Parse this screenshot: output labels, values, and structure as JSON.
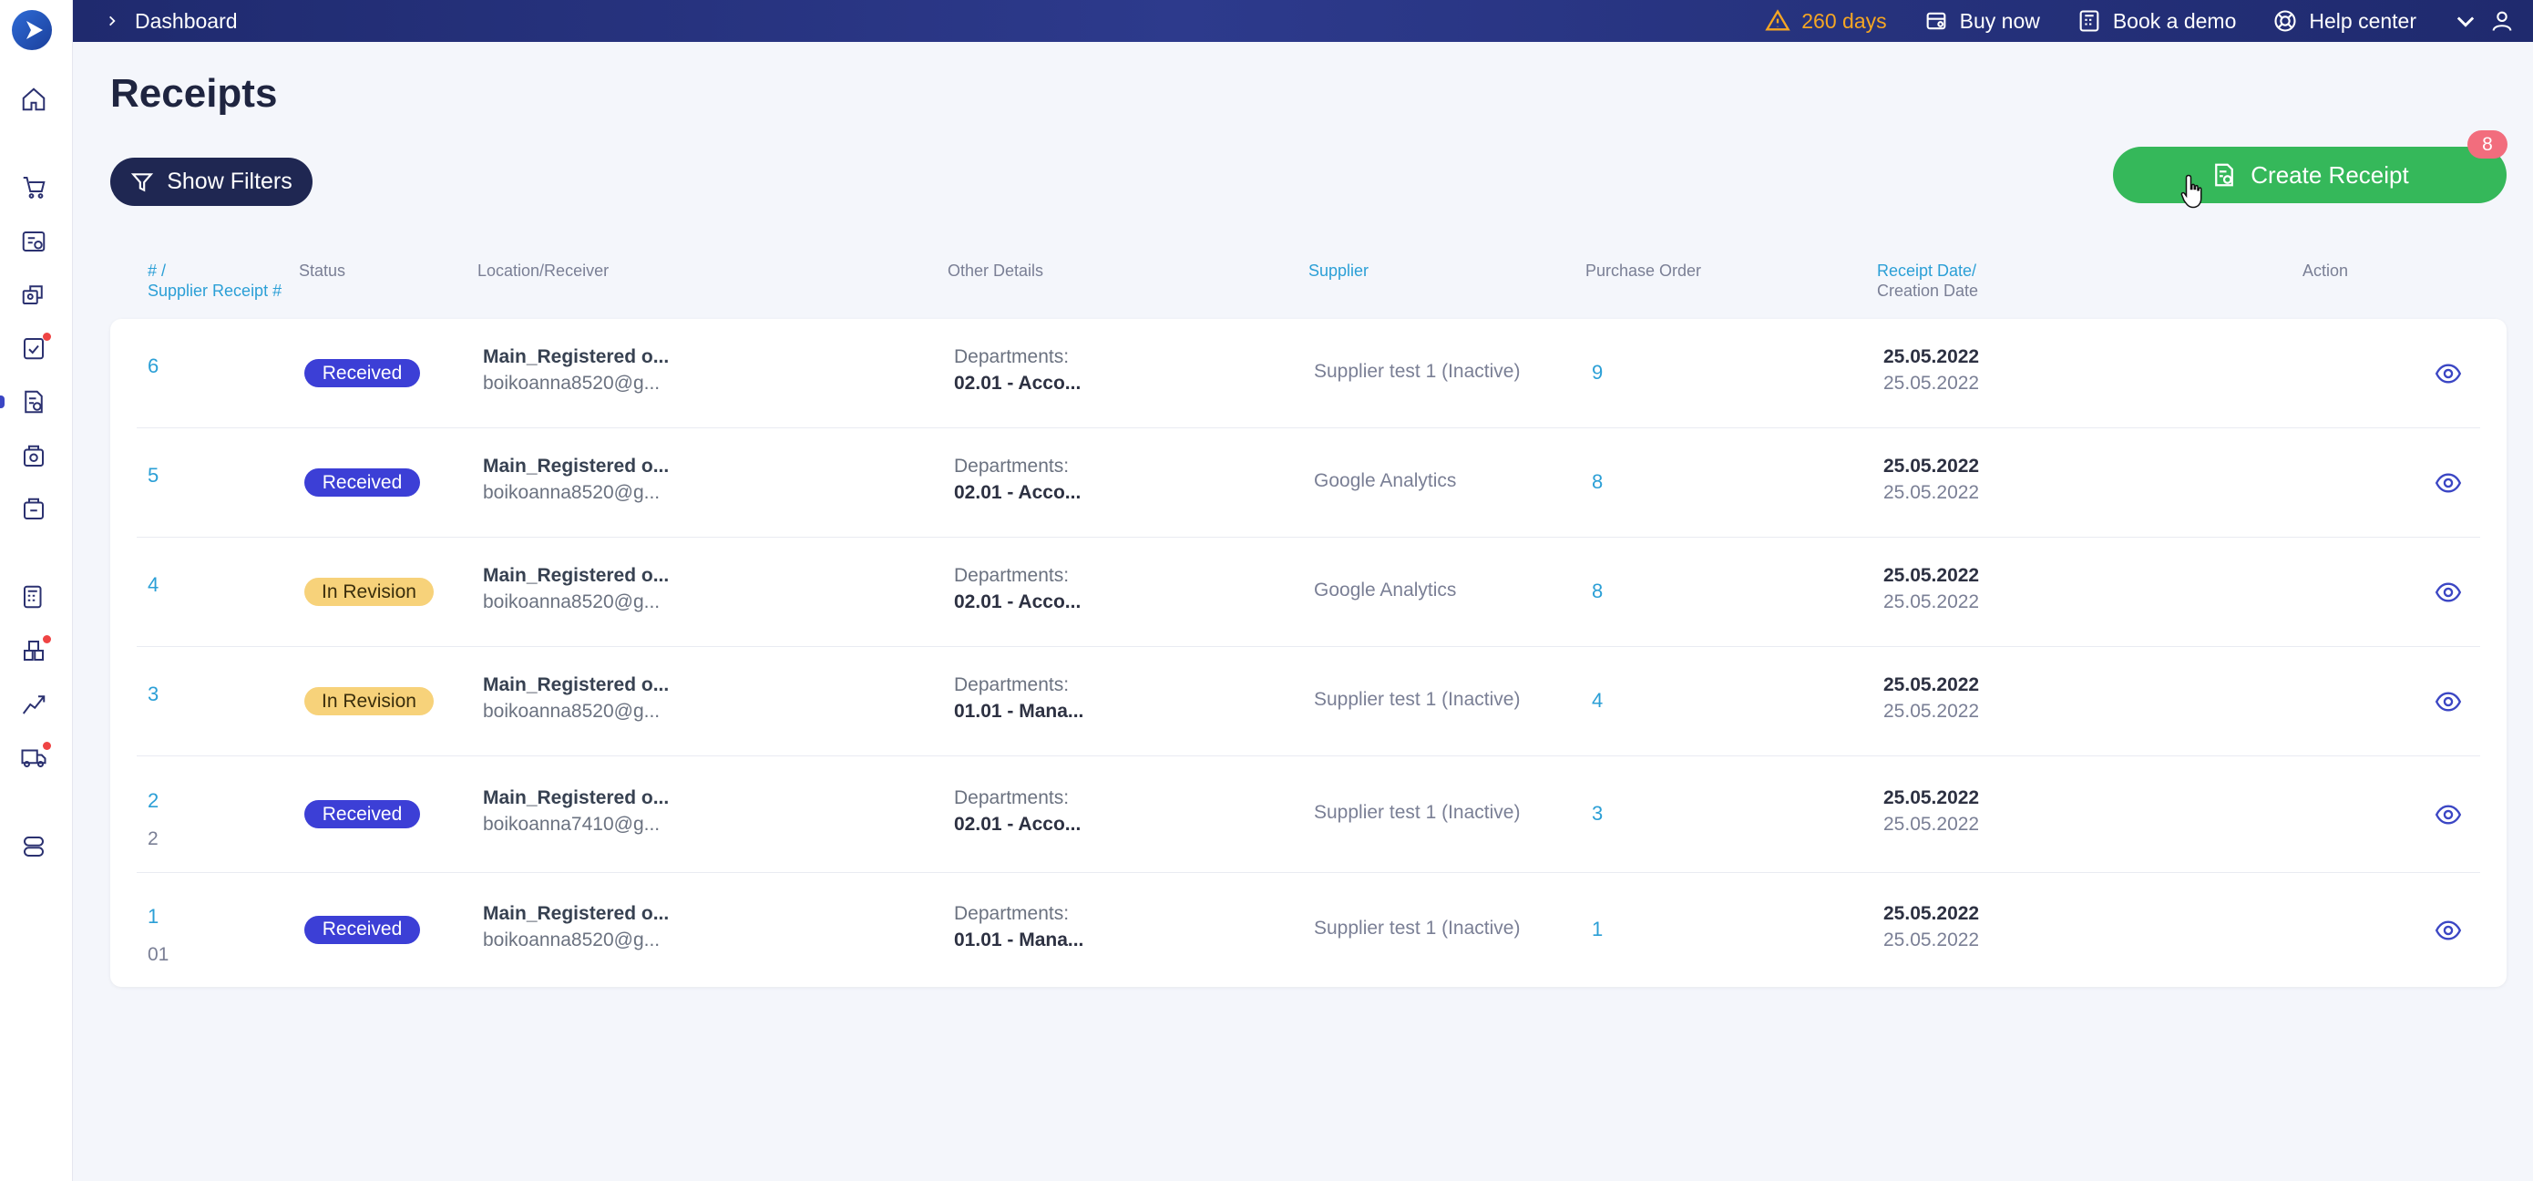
{
  "topbar": {
    "breadcrumb": "Dashboard",
    "trial": "260 days",
    "buy_now": "Buy now",
    "book_demo": "Book a demo",
    "help_center": "Help center"
  },
  "page": {
    "title": "Receipts",
    "show_filters": "Show Filters",
    "create_receipt": "Create Receipt",
    "notification_count": "8"
  },
  "table": {
    "headers": {
      "number_line1": "# /",
      "number_line2": "Supplier Receipt #",
      "status": "Status",
      "location": "Location/Receiver",
      "other_details": "Other Details",
      "supplier": "Supplier",
      "purchase_order": "Purchase Order",
      "date_line1": "Receipt Date/",
      "date_line2": "Creation Date",
      "action": "Action"
    },
    "rows": [
      {
        "num": "6",
        "sub_num": "",
        "status": "Received",
        "status_type": "received",
        "location": "Main_Registered o...",
        "receiver": "boikoanna8520@g...",
        "dep_label": "Departments:",
        "dep_value": "02.01 - Acco...",
        "supplier": "Supplier test 1 (Inactive)",
        "po": "9",
        "receipt_date": "25.05.2022",
        "creation_date": "25.05.2022"
      },
      {
        "num": "5",
        "sub_num": "",
        "status": "Received",
        "status_type": "received",
        "location": "Main_Registered o...",
        "receiver": "boikoanna8520@g...",
        "dep_label": "Departments:",
        "dep_value": "02.01 - Acco...",
        "supplier": "Google Analytics",
        "po": "8",
        "receipt_date": "25.05.2022",
        "creation_date": "25.05.2022"
      },
      {
        "num": "4",
        "sub_num": "",
        "status": "In Revision",
        "status_type": "revision",
        "location": "Main_Registered o...",
        "receiver": "boikoanna8520@g...",
        "dep_label": "Departments:",
        "dep_value": "02.01 - Acco...",
        "supplier": "Google Analytics",
        "po": "8",
        "receipt_date": "25.05.2022",
        "creation_date": "25.05.2022"
      },
      {
        "num": "3",
        "sub_num": "",
        "status": "In Revision",
        "status_type": "revision",
        "location": "Main_Registered o...",
        "receiver": "boikoanna8520@g...",
        "dep_label": "Departments:",
        "dep_value": "01.01 - Mana...",
        "supplier": "Supplier test 1 (Inactive)",
        "po": "4",
        "receipt_date": "25.05.2022",
        "creation_date": "25.05.2022"
      },
      {
        "num": "2",
        "sub_num": "2",
        "status": "Received",
        "status_type": "received",
        "location": "Main_Registered o...",
        "receiver": "boikoanna7410@g...",
        "dep_label": "Departments:",
        "dep_value": "02.01 - Acco...",
        "supplier": "Supplier test 1 (Inactive)",
        "po": "3",
        "receipt_date": "25.05.2022",
        "creation_date": "25.05.2022"
      },
      {
        "num": "1",
        "sub_num": "01",
        "status": "Received",
        "status_type": "received",
        "location": "Main_Registered o...",
        "receiver": "boikoanna8520@g...",
        "dep_label": "Departments:",
        "dep_value": "01.01 - Mana...",
        "supplier": "Supplier test 1 (Inactive)",
        "po": "1",
        "receipt_date": "25.05.2022",
        "creation_date": "25.05.2022"
      }
    ]
  },
  "colors": {
    "received": "#3c3fd6",
    "revision": "#f7d27a",
    "create": "#35b85a",
    "link": "#2b9fd6"
  }
}
